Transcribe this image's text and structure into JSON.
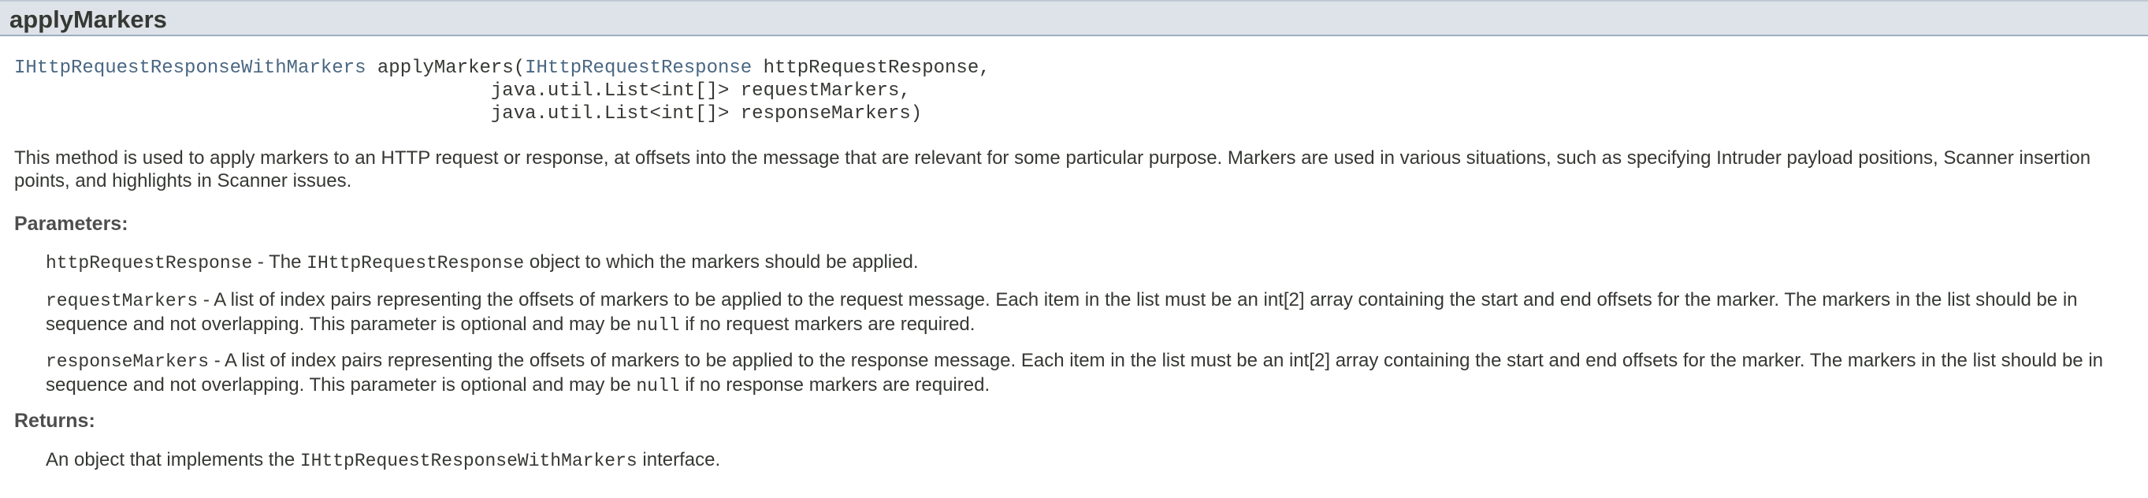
{
  "header": {
    "title": "applyMarkers"
  },
  "signature": {
    "return_type": "IHttpRequestResponseWithMarkers",
    "method_name": "applyMarkers(",
    "param1_type": "IHttpRequestResponse",
    "param1_name": " httpRequestResponse,",
    "line2": "java.util.List<int[]> requestMarkers,",
    "line3": "java.util.List<int[]> responseMarkers)"
  },
  "description": "This method is used to apply markers to an HTTP request or response, at offsets into the message that are relevant for some particular purpose. Markers are used in various situations, such as specifying Intruder payload positions, Scanner insertion points, and highlights in Scanner issues.",
  "parameters_label": "Parameters:",
  "params": [
    {
      "name": "httpRequestResponse",
      "text_before": " - The ",
      "code": "IHttpRequestResponse",
      "text_after": " object to which the markers should be applied."
    },
    {
      "name": "requestMarkers",
      "text_before": " - A list of index pairs representing the offsets of markers to be applied to the request message. Each item in the list must be an int[2] array containing the start and end offsets for the marker. The markers in the list should be in sequence and not overlapping. This parameter is optional and may be ",
      "code": "null",
      "text_after": " if no request markers are required."
    },
    {
      "name": "responseMarkers",
      "text_before": " - A list of index pairs representing the offsets of markers to be applied to the response message. Each item in the list must be an int[2] array containing the start and end offsets for the marker. The markers in the list should be in sequence and not overlapping. This parameter is optional and may be ",
      "code": "null",
      "text_after": " if no response markers are required."
    }
  ],
  "returns_label": "Returns:",
  "returns": {
    "text_before": "An object that implements the ",
    "code": "IHttpRequestResponseWithMarkers",
    "text_after": " interface."
  }
}
